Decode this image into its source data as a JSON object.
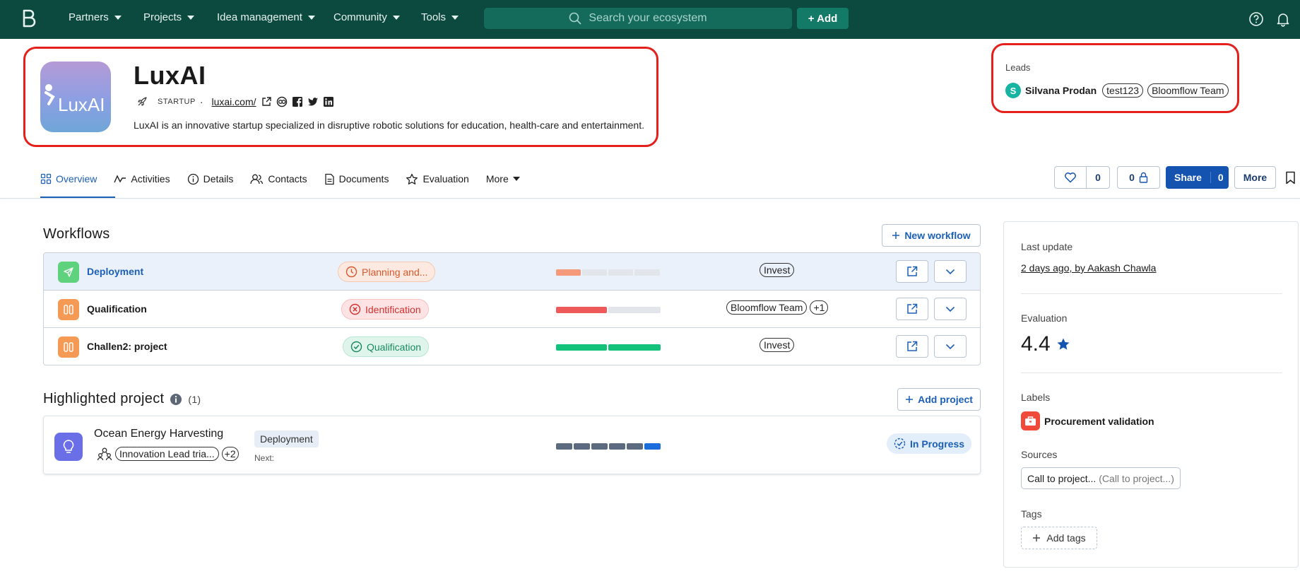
{
  "nav": {
    "items": [
      {
        "label": "Partners"
      },
      {
        "label": "Projects"
      },
      {
        "label": "Idea management"
      },
      {
        "label": "Community"
      },
      {
        "label": "Tools"
      }
    ],
    "search_placeholder": "Search your ecosystem",
    "add_label": "+ Add"
  },
  "company": {
    "logo_text": "LuxAI",
    "name": "LuxAI",
    "type": "STARTUP",
    "website": "luxai.com/",
    "description": "LuxAI is an innovative startup specialized in disruptive robotic solutions for education, health-care and entertainment."
  },
  "leads": {
    "label": "Leads",
    "avatar_initial": "S",
    "name": "Silvana Prodan",
    "tags": [
      "test123",
      "Bloomflow Team"
    ]
  },
  "tabs": [
    {
      "label": "Overview",
      "icon": "grid-icon"
    },
    {
      "label": "Activities",
      "icon": "activity-icon"
    },
    {
      "label": "Details",
      "icon": "info-icon"
    },
    {
      "label": "Contacts",
      "icon": "contacts-icon"
    },
    {
      "label": "Documents",
      "icon": "document-icon"
    },
    {
      "label": "Evaluation",
      "icon": "star-icon"
    },
    {
      "label": "More",
      "icon": "caret-icon"
    }
  ],
  "actions": {
    "likes": "0",
    "private_count": "0",
    "share_label": "Share",
    "share_count": "0",
    "more_label": "More"
  },
  "workflows": {
    "title": "Workflows",
    "new_label": "New workflow",
    "rows": [
      {
        "name": "Deployment",
        "status": "Planning and...",
        "tags": [
          "Invest"
        ],
        "progress": 0.25
      },
      {
        "name": "Qualification",
        "status": "Identification",
        "tags": [
          "Bloomflow Team",
          "+1"
        ],
        "progress": 0.5
      },
      {
        "name": "Challen2: project",
        "status": "Qualification",
        "tags": [
          "Invest"
        ],
        "progress": 1.0
      }
    ]
  },
  "highlighted": {
    "title": "Highlighted project",
    "count": "(1)",
    "add_label": "Add project",
    "project": {
      "name": "Ocean Energy Harvesting",
      "tag": "Innovation Lead tria...",
      "more": "+2",
      "stage": "Deployment",
      "next": "Next:",
      "status": "In Progress",
      "progress_segments_done": 5,
      "progress_segments_total": 6
    }
  },
  "side": {
    "last_update_label": "Last update",
    "last_update_value": "2 days ago, by Aakash Chawla",
    "evaluation_label": "Evaluation",
    "evaluation_value": "4.4",
    "labels_label": "Labels",
    "label_value": "Procurement validation",
    "sources_label": "Sources",
    "source_main": "Call to project...",
    "source_sub": "(Call to project...)",
    "tags_label": "Tags",
    "add_tags": "Add tags"
  },
  "colors": {
    "nav_bg": "#0c4a3f",
    "accent_blue": "#1b5fb8",
    "highlight_red": "#e3201b"
  }
}
